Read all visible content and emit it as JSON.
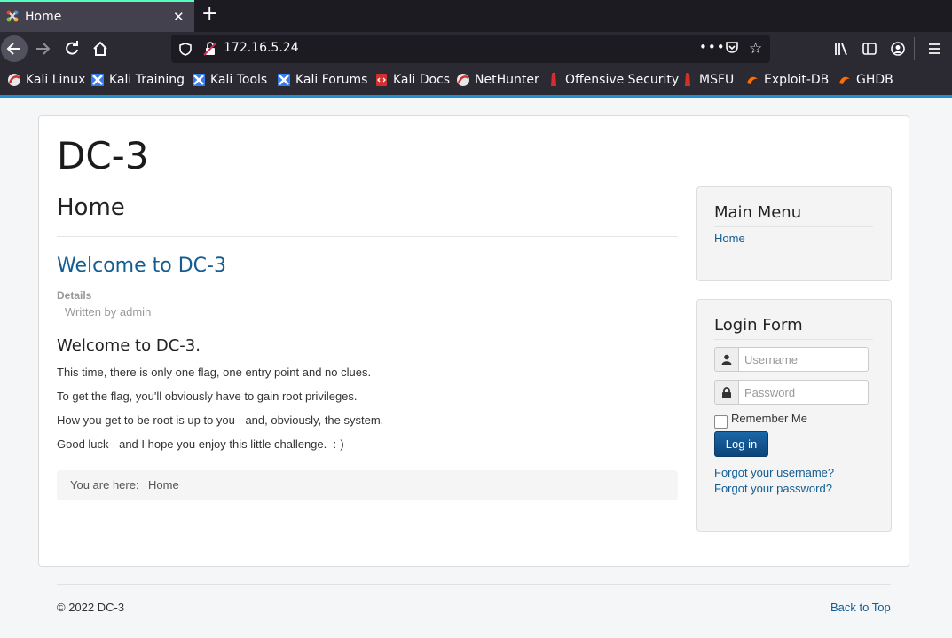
{
  "browser": {
    "tab_title": "Home",
    "url": "172.16.5.24",
    "url_more": "•••",
    "bookmarks": [
      "Kali Linux",
      "Kali Training",
      "Kali Tools",
      "Kali Forums",
      "Kali Docs",
      "NetHunter",
      "Offensive Security",
      "MSFU",
      "Exploit-DB",
      "GHDB"
    ],
    "accent_color": "#1f8fcf",
    "icons": [
      "joomla-favicon-icon",
      "close-icon",
      "plus-icon",
      "back-arrow-icon",
      "forward-arrow-icon",
      "reload-icon",
      "home-icon",
      "shield-icon",
      "insecure-lock-icon",
      "more-icon",
      "pocket-icon",
      "star-icon",
      "library-icon",
      "sidebar-icon",
      "account-icon",
      "hamburger-menu-icon"
    ]
  },
  "site": {
    "title": "DC-3",
    "page_heading": "Home",
    "article": {
      "title": "Welcome to DC-3",
      "details_label": "Details",
      "written_by": "Written by admin",
      "subheading": "Welcome to DC-3.",
      "paragraphs": [
        "This time, there is only one flag, one entry point and no clues.",
        "To get the flag, you'll obviously have to gain root privileges.",
        "How you get to be root is up to you - and, obviously, the system.",
        "Good luck - and I hope you enjoy this little challenge.  :-)"
      ]
    },
    "breadcrumb": {
      "label": "You are here:",
      "current": "Home"
    },
    "main_menu": {
      "title": "Main Menu",
      "items": [
        "Home"
      ]
    },
    "login_form": {
      "title": "Login Form",
      "username_placeholder": "Username",
      "password_placeholder": "Password",
      "remember_label": "Remember Me",
      "login_button": "Log in",
      "forgot_username": "Forgot your username?",
      "forgot_password": "Forgot your password?"
    },
    "footer": {
      "copyright": "© 2022 DC-3",
      "back_to_top": "Back to Top"
    },
    "link_color": "#135d92"
  }
}
